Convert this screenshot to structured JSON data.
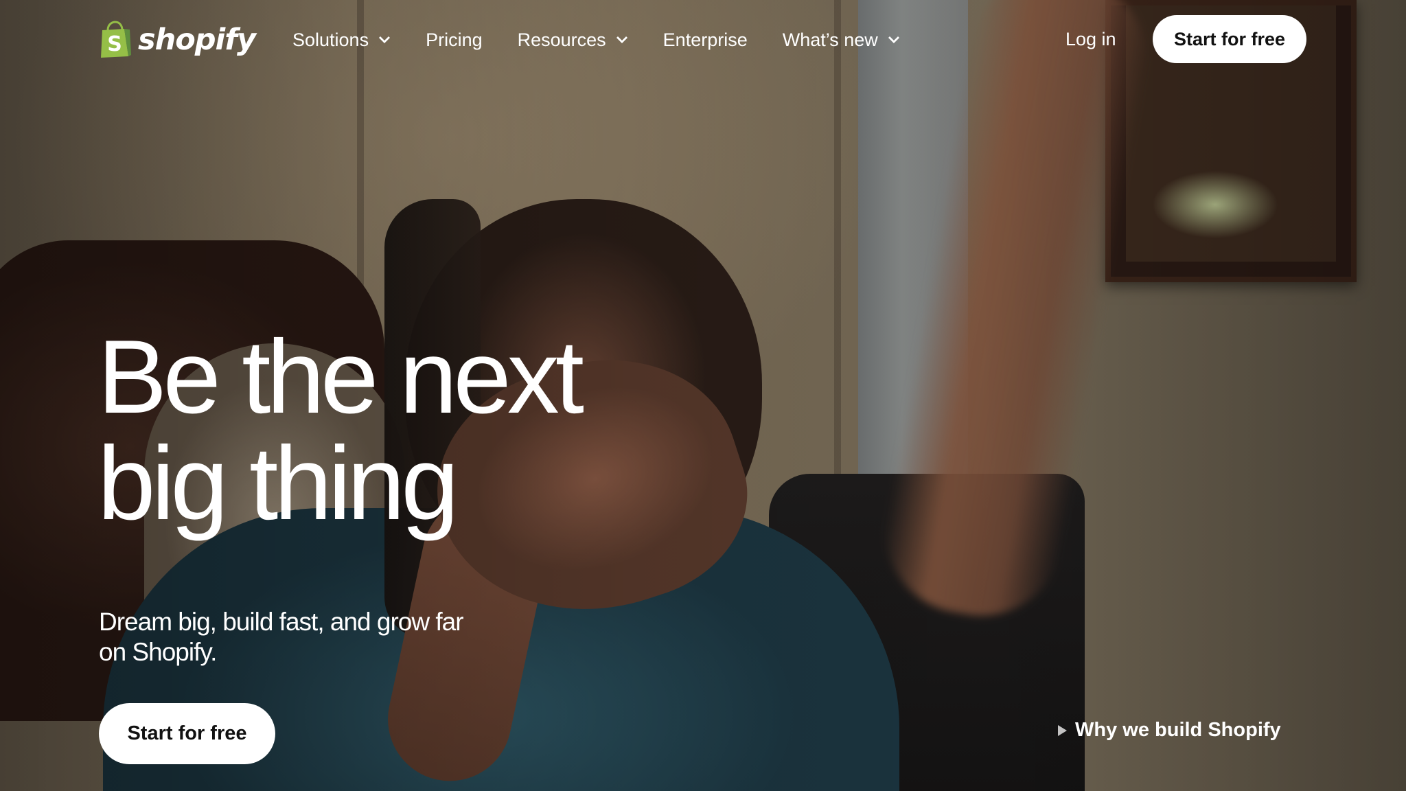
{
  "brand": {
    "name": "shopify",
    "logo_color": "#95bf47"
  },
  "nav": {
    "items": [
      {
        "label": "Solutions",
        "has_dropdown": true
      },
      {
        "label": "Pricing",
        "has_dropdown": false
      },
      {
        "label": "Resources",
        "has_dropdown": true
      },
      {
        "label": "Enterprise",
        "has_dropdown": false
      },
      {
        "label": "What’s new",
        "has_dropdown": true
      }
    ],
    "login_label": "Log in",
    "cta_label": "Start for free"
  },
  "hero": {
    "headline_line1": "Be the next",
    "headline_line2": "big thing",
    "subheading": "Dream big, build fast, and grow far on Shopify.",
    "cta_label": "Start for free",
    "video_link_label": "Why we build Shopify",
    "video_link_icon": "play-icon"
  }
}
